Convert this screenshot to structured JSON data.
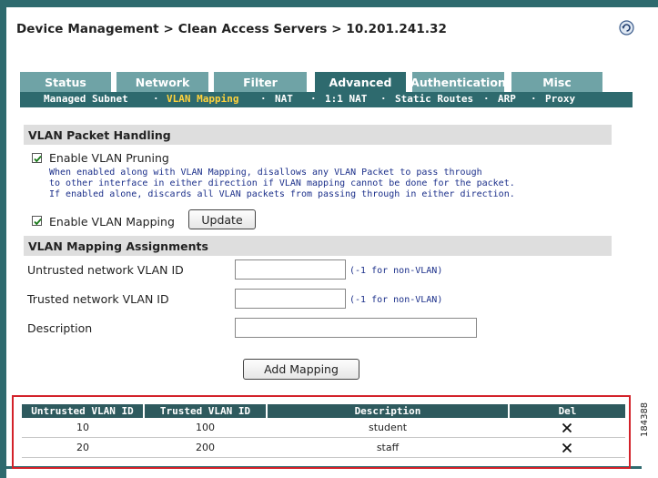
{
  "breadcrumb": "Device Management > Clean Access Servers > 10.201.241.32",
  "tabs": [
    {
      "label": "Status",
      "active": false
    },
    {
      "label": "Network",
      "active": false
    },
    {
      "label": "Filter",
      "active": false
    },
    {
      "label": "Advanced",
      "active": true
    },
    {
      "label": "Authentication",
      "active": false
    },
    {
      "label": "Misc",
      "active": false
    }
  ],
  "subnav": {
    "items": [
      "Managed Subnet",
      "VLAN Mapping",
      "NAT",
      "1:1 NAT",
      "Static Routes",
      "ARP",
      "Proxy"
    ],
    "active": "VLAN Mapping",
    "separator": "·"
  },
  "packet_handling": {
    "header": "VLAN Packet Handling",
    "pruning_label": "Enable VLAN Pruning",
    "pruning_checked": true,
    "help_text": "When enabled along with VLAN Mapping, disallows any VLAN Packet to pass through\nto other interface in either direction if VLAN mapping cannot be done for the packet.\nIf enabled alone, discards all VLAN packets from passing through in either direction.",
    "mapping_label": "Enable VLAN Mapping",
    "mapping_checked": true,
    "update_button": "Update"
  },
  "assignments": {
    "header": "VLAN Mapping Assignments",
    "untrusted_label": "Untrusted network VLAN ID",
    "untrusted_value": "",
    "untrusted_hint": "(-1 for non-VLAN)",
    "trusted_label": "Trusted network VLAN ID",
    "trusted_value": "",
    "trusted_hint": "(-1 for non-VLAN)",
    "description_label": "Description",
    "description_value": "",
    "add_button": "Add Mapping"
  },
  "table": {
    "columns": [
      "Untrusted VLAN ID",
      "Trusted VLAN ID",
      "Description",
      "Del"
    ],
    "rows": [
      {
        "untrusted": "10",
        "trusted": "100",
        "description": "student"
      },
      {
        "untrusted": "20",
        "trusted": "200",
        "description": "staff"
      }
    ]
  },
  "figure_number": "184388",
  "colors": {
    "frame": "#2e6a6e",
    "tab_inactive": "#6fa3a6",
    "tab_active": "#2e6a6e",
    "subnav_active": "#ffd23c",
    "table_header": "#2e5a5e",
    "highlight_box": "#d3222a",
    "help_text": "#1b2f8a"
  }
}
